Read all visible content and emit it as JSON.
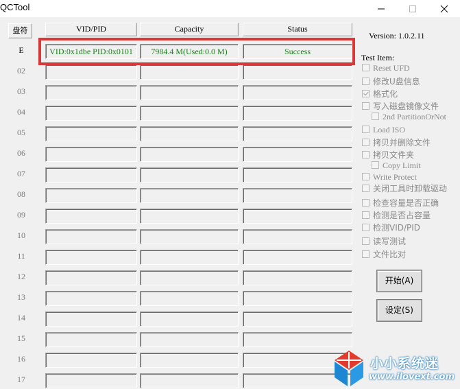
{
  "window": {
    "title": "QCTool",
    "minimize": "minimize",
    "maximize": "maximize",
    "close": "close"
  },
  "table": {
    "disk_header": "盘符",
    "columns": [
      "VID/PID",
      "Capacity",
      "Status"
    ],
    "rows": [
      {
        "label": "E",
        "vidpid": "VID:0x1dbe PID:0x0101",
        "capacity": "7984.4 M(Used:0.0 M)",
        "status": "Success"
      },
      {
        "label": "02",
        "vidpid": "",
        "capacity": "",
        "status": ""
      },
      {
        "label": "03",
        "vidpid": "",
        "capacity": "",
        "status": ""
      },
      {
        "label": "04",
        "vidpid": "",
        "capacity": "",
        "status": ""
      },
      {
        "label": "05",
        "vidpid": "",
        "capacity": "",
        "status": ""
      },
      {
        "label": "06",
        "vidpid": "",
        "capacity": "",
        "status": ""
      },
      {
        "label": "07",
        "vidpid": "",
        "capacity": "",
        "status": ""
      },
      {
        "label": "08",
        "vidpid": "",
        "capacity": "",
        "status": ""
      },
      {
        "label": "09",
        "vidpid": "",
        "capacity": "",
        "status": ""
      },
      {
        "label": "10",
        "vidpid": "",
        "capacity": "",
        "status": ""
      },
      {
        "label": "11",
        "vidpid": "",
        "capacity": "",
        "status": ""
      },
      {
        "label": "12",
        "vidpid": "",
        "capacity": "",
        "status": ""
      },
      {
        "label": "13",
        "vidpid": "",
        "capacity": "",
        "status": ""
      },
      {
        "label": "14",
        "vidpid": "",
        "capacity": "",
        "status": ""
      },
      {
        "label": "15",
        "vidpid": "",
        "capacity": "",
        "status": ""
      },
      {
        "label": "16",
        "vidpid": "",
        "capacity": "",
        "status": ""
      },
      {
        "label": "17",
        "vidpid": "",
        "capacity": "",
        "status": ""
      }
    ]
  },
  "side": {
    "version": "Version: 1.0.2.11",
    "test_item": "Test Item:",
    "options": [
      {
        "label": "Reset UFD",
        "checked": false,
        "enabled": false,
        "indent": 0
      },
      {
        "label": "修改U盘信息",
        "checked": false,
        "enabled": false,
        "indent": 0
      },
      {
        "label": "格式化",
        "checked": true,
        "enabled": false,
        "indent": 0
      },
      {
        "label": "写入磁盘镜像文件",
        "checked": false,
        "enabled": false,
        "indent": 0
      },
      {
        "label": "2nd PartitionOrNot",
        "checked": false,
        "enabled": false,
        "indent": 1
      },
      {
        "label": "Load ISO",
        "checked": false,
        "enabled": false,
        "indent": 0
      },
      {
        "label": "拷贝并删除文件",
        "checked": false,
        "enabled": false,
        "indent": 0
      },
      {
        "label": "拷贝文件夹",
        "checked": false,
        "enabled": false,
        "indent": 0
      },
      {
        "label": "Copy Limit",
        "checked": false,
        "enabled": false,
        "indent": 1
      },
      {
        "label": "Write Protect",
        "checked": false,
        "enabled": false,
        "indent": 0
      },
      {
        "label": "关闭工具时卸载驱动",
        "checked": false,
        "enabled": false,
        "indent": 0
      },
      {
        "label": "检查容量是否正确",
        "checked": false,
        "enabled": false,
        "indent": 0
      },
      {
        "label": "检测是否占容量",
        "checked": false,
        "enabled": false,
        "indent": 0
      },
      {
        "label": "检测VID/PID",
        "checked": false,
        "enabled": false,
        "indent": 0
      },
      {
        "label": "读写测试",
        "checked": false,
        "enabled": false,
        "indent": 0
      },
      {
        "label": "文件比对",
        "checked": false,
        "enabled": false,
        "indent": 0
      }
    ],
    "start_button": "开始(A)",
    "settings_button": "设定(S)"
  },
  "watermark": {
    "text": "小小系统迷",
    "url": "www.ilovext.com"
  },
  "colors": {
    "status_text": "#1a7f1a",
    "highlight": "#d9383a",
    "window_bg": "#f0f0f0"
  }
}
